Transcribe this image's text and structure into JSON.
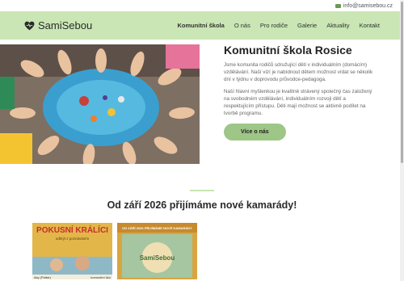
{
  "topbar": {
    "email": "info@samisebou.cz"
  },
  "brand": {
    "name": "SamiSebou"
  },
  "nav": {
    "items": [
      "Komunitní škola",
      "O nás",
      "Pro rodiče",
      "Galerie",
      "Aktuality",
      "Kontakt"
    ]
  },
  "hero": {
    "title": "Komunitní škola Rosice",
    "p1": "Jsme komunita rodičů sdružující děti v individuálním (domácím) vzdělávání. Naší vizí je nabídnout dětem možnost vídat se několik dní v týdnu v doprovodu průvodce-pedagoga.",
    "p2": "Naší hlavní myšlenkou je kvalitně strávený společný čas založený na svobodném vzdělávání, individuálním rozvoji dětí a respektujícím přístupu. Děti mají možnost se aktivně podílet na tvorbě programu.",
    "button": "Více o nás"
  },
  "announcement": {
    "title": "Od září 2026 přijímáme nové kamarády!"
  },
  "cards": {
    "card1": {
      "title": "POKUSNÍ KRÁLÍCI",
      "subtitle": "odkrýt z poznáváním",
      "footer_left": "day (Pattar)",
      "footer_right": "komunitní ško"
    },
    "card2": {
      "top": "OD ZÁŘÍ 2026 PŘIJÍMÁME NOVÉ KAMARÁDY",
      "logo": "SamiSebou"
    }
  },
  "colors": {
    "nav_bg": "#c9e6b4",
    "accent": "#9ec687",
    "text": "#444444"
  }
}
